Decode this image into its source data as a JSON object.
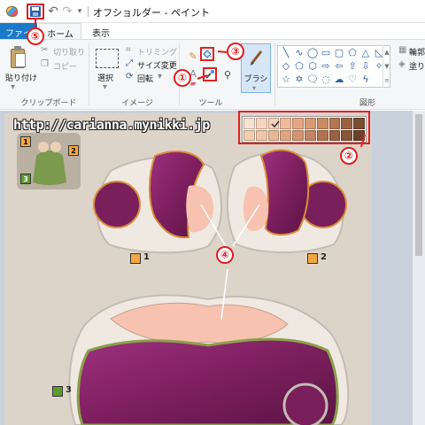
{
  "window": {
    "title": "オフショルダー - ペイント"
  },
  "tabs": [
    {
      "label": "ファイル"
    },
    {
      "label": "ホーム"
    },
    {
      "label": "表示"
    }
  ],
  "ribbon": {
    "clipboard": {
      "paste_label": "貼り付け",
      "cut_label": "切り取り",
      "copy_label": "コピー",
      "group_label": "クリップボード"
    },
    "image": {
      "select_label": "選択",
      "crop_label": "トリミング",
      "resize_label": "サイズ変更",
      "rotate_label": "回転",
      "group_label": "イメージ"
    },
    "tools": {
      "group_label": "ツール",
      "brush_label": "ブラシ"
    },
    "shapes": {
      "outline_label": "輪郭",
      "fill_label": "塗りつ",
      "group_label": "図形"
    }
  },
  "canvas": {
    "watermark": "http://carianna.mynikki.jp",
    "piece_labels": [
      "1",
      "2",
      "3"
    ],
    "palette_colors": [
      "#f7e2d0",
      "#f7d6bf",
      "#f5d2bc",
      "#efb99a",
      "#e8a583",
      "#d89a72",
      "#c98b62",
      "#b47650",
      "#9a6340",
      "#7b4e33",
      "#f2cdb1",
      "#efc6a6",
      "#e9b796",
      "#dfa582",
      "#d29471",
      "#c38461",
      "#b07251",
      "#9a6142",
      "#875437",
      "#6c422b"
    ],
    "selected_color_index": 2
  },
  "callouts": [
    "①",
    "②",
    "③",
    "④",
    "⑤"
  ],
  "colors": {
    "file_tab": "#1979ca",
    "callout_red": "#e02020",
    "fabric_purple": "#7d1f5e",
    "skin_pink": "#f7c2b0",
    "canvas_beige": "#ddd4c9",
    "badge_orange": "#f4a740",
    "badge_green": "#5e9a33"
  },
  "icons": [
    "paint-app-icon",
    "save-icon",
    "undo-icon",
    "redo-icon",
    "color-picker-icon",
    "fill-bucket-icon",
    "magnifier-icon",
    "pencil-icon",
    "brush-icon"
  ]
}
